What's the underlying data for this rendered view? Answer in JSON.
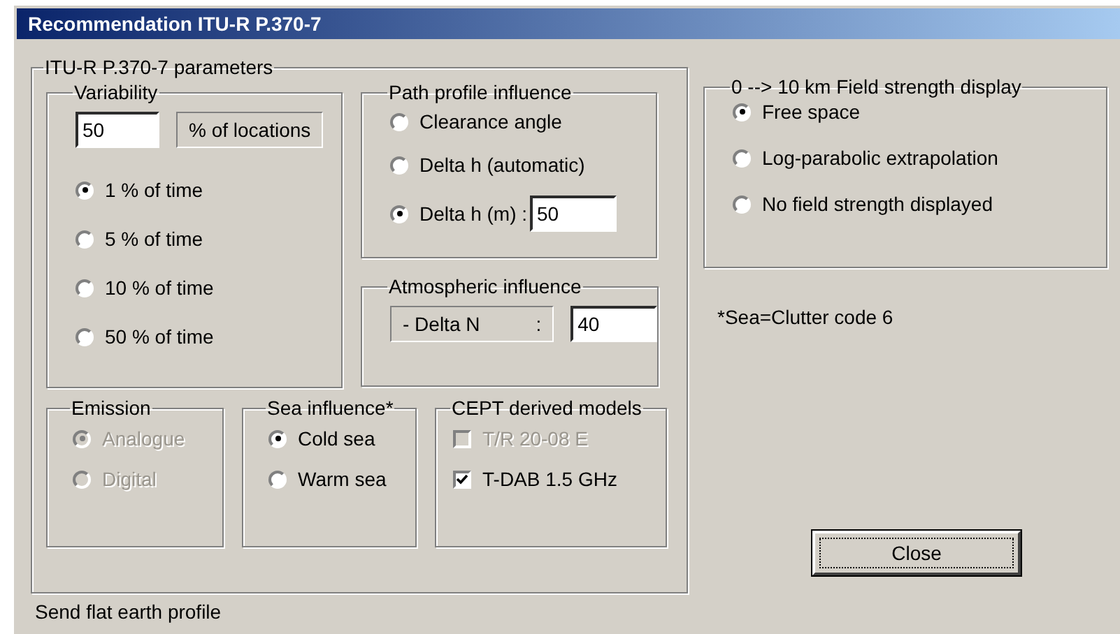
{
  "window": {
    "title": "Recommendation ITU-R P.370-7"
  },
  "parameters": {
    "legend": "ITU-R P.370-7 parameters",
    "variability": {
      "legend": "Variability",
      "locations_value": "50",
      "locations_label": "% of locations",
      "options": [
        {
          "label": "1 % of time",
          "selected": true
        },
        {
          "label": "5 % of time",
          "selected": false
        },
        {
          "label": "10 % of time",
          "selected": false
        },
        {
          "label": "50 % of time",
          "selected": false
        }
      ]
    },
    "path_profile": {
      "legend": "Path profile influence",
      "options": [
        {
          "label": "Clearance angle",
          "selected": false
        },
        {
          "label": "Delta h (automatic)",
          "selected": false
        },
        {
          "label": "Delta h (m) :",
          "selected": true,
          "value": "50"
        }
      ]
    },
    "atmospheric": {
      "legend": "Atmospheric influence",
      "label": "- Delta N",
      "separator": ":",
      "value": "40"
    },
    "emission": {
      "legend": "Emission",
      "options": [
        {
          "label": "Analogue",
          "selected": true,
          "disabled": true
        },
        {
          "label": "Digital",
          "selected": false,
          "disabled": true
        }
      ]
    },
    "sea": {
      "legend": "Sea influence*",
      "options": [
        {
          "label": "Cold sea",
          "selected": true,
          "disabled": false
        },
        {
          "label": "Warm sea",
          "selected": false,
          "disabled": false
        }
      ]
    },
    "cept": {
      "legend": "CEPT derived models",
      "items": [
        {
          "label": "T/R 20-08 E",
          "checked": false,
          "disabled": true
        },
        {
          "label": "T-DAB 1.5 GHz",
          "checked": true,
          "disabled": false
        }
      ]
    }
  },
  "field_strength": {
    "legend": "0 --> 10 km Field strength display",
    "options": [
      {
        "label": "Free space",
        "selected": true
      },
      {
        "label": "Log-parabolic extrapolation",
        "selected": false
      },
      {
        "label": "No field strength displayed",
        "selected": false
      }
    ]
  },
  "sea_note": "*Sea=Clutter code 6",
  "close_button": "Close",
  "status": "Send flat earth profile"
}
